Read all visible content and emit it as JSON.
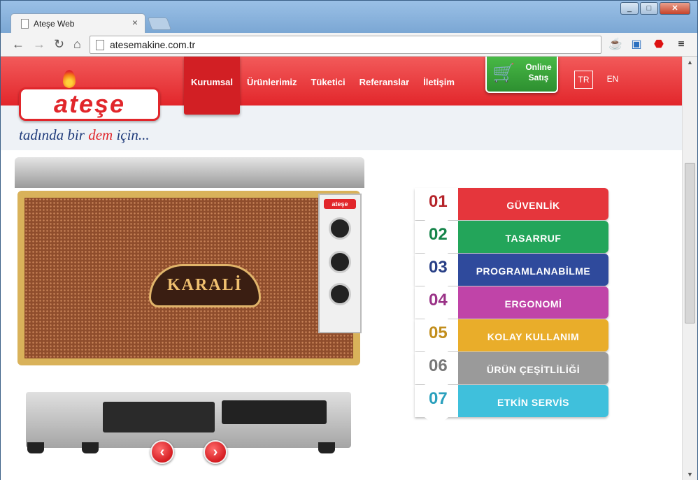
{
  "browser": {
    "tab_title": "Ateşe Web",
    "tab_close": "×",
    "url": "atesemakine.com.tr",
    "window_buttons": [
      "_",
      "□",
      "✕"
    ]
  },
  "site": {
    "logo_text": "ateşe",
    "slogan_part1": "tadında bir",
    "slogan_red": "dem",
    "slogan_part2": "için...",
    "nav": [
      {
        "label": "Kurumsal",
        "active": true
      },
      {
        "label": "Ürünlerimiz",
        "active": false
      },
      {
        "label": "Tüketici",
        "active": false
      },
      {
        "label": "Referanslar",
        "active": false
      },
      {
        "label": "İletişim",
        "active": false
      }
    ],
    "online_line1": "Online",
    "online_line2": "Satış",
    "lang_tr": "TR",
    "lang_en": "EN",
    "product_badge": "KARALİ",
    "panel_badge": "ateşe",
    "prev_arrow": "‹",
    "next_arrow": "›"
  },
  "features": [
    {
      "num": "01",
      "label": "GÜVENLİK",
      "color": "#e5363c",
      "num_color": "#b52329"
    },
    {
      "num": "02",
      "label": "TASARRUF",
      "color": "#23a55a",
      "num_color": "#16844a"
    },
    {
      "num": "03",
      "label": "PROGRAMLANABİLME",
      "color": "#2f4a9c",
      "num_color": "#283f86"
    },
    {
      "num": "04",
      "label": "ERGONOMİ",
      "color": "#c044a8",
      "num_color": "#9a3287"
    },
    {
      "num": "05",
      "label": "KOLAY KULLANIM",
      "color": "#e9ad2a",
      "num_color": "#c28e1c"
    },
    {
      "num": "06",
      "label": "ÜRÜN ÇEŞİTLİLİĞİ",
      "color": "#9a9a9a",
      "num_color": "#777777"
    },
    {
      "num": "07",
      "label": "ETKİN SERVİS",
      "color": "#3fc0dc",
      "num_color": "#2aa0bd"
    }
  ]
}
